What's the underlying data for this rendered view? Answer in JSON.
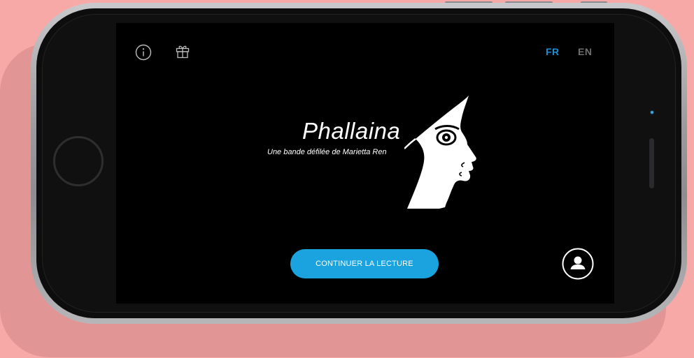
{
  "app": {
    "title": "Phallaina",
    "subtitle": "Une bande défilée de Marietta Ren"
  },
  "toolbar": {
    "info_icon": "info-icon",
    "gift_icon": "gift-icon"
  },
  "language": {
    "options": [
      "FR",
      "EN"
    ],
    "selected": "FR"
  },
  "actions": {
    "continue_label": "CONTINUER LA LECTURE",
    "profile_icon": "user-icon"
  },
  "colors": {
    "background": "#f7a9a8",
    "screen": "#000000",
    "accent": "#1aa3df",
    "lang_active": "#1a8fd4",
    "lang_inactive": "#6e6e6e"
  }
}
